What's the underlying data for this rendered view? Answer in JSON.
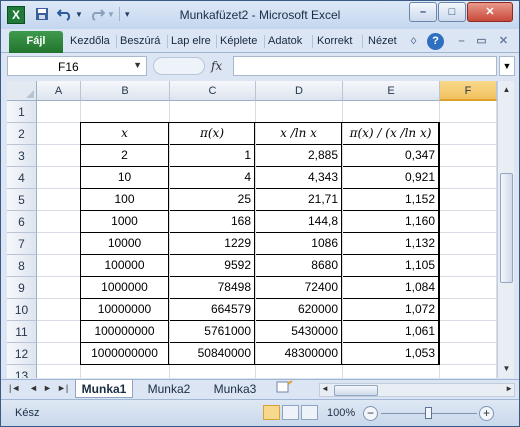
{
  "window": {
    "title": "Munkafüzet2 - Microsoft Excel"
  },
  "qat": {
    "save_icon": "save-icon",
    "undo_icon": "undo-icon",
    "redo_icon": "redo-icon"
  },
  "window_controls": {
    "minimize": "–",
    "maximize": "□",
    "close": "✕"
  },
  "ribbon": {
    "file_tab": "Fájl",
    "tabs": [
      "Kezdőla",
      "Beszúrá",
      "Lap elre",
      "Képlete",
      "Adatok",
      "Korrekt",
      "Nézet"
    ]
  },
  "formula_bar": {
    "name_box": "F16",
    "fx": "fx",
    "content": ""
  },
  "grid": {
    "columns": [
      "A",
      "B",
      "C",
      "D",
      "E",
      "F"
    ],
    "selected_column": "F",
    "rows": [
      "1",
      "2",
      "3",
      "4",
      "5",
      "6",
      "7",
      "8",
      "9",
      "10",
      "11",
      "12",
      "13"
    ],
    "table_headers": [
      "x",
      "π(x)",
      "x /ln x",
      "π(x) / (x /ln x)"
    ],
    "table_rows": [
      [
        "2",
        "1",
        "2,885",
        "0,347"
      ],
      [
        "10",
        "4",
        "4,343",
        "0,921"
      ],
      [
        "100",
        "25",
        "21,71",
        "1,152"
      ],
      [
        "1000",
        "168",
        "144,8",
        "1,160"
      ],
      [
        "10000",
        "1229",
        "1086",
        "1,132"
      ],
      [
        "100000",
        "9592",
        "8680",
        "1,105"
      ],
      [
        "1000000",
        "78498",
        "72400",
        "1,084"
      ],
      [
        "10000000",
        "664579",
        "620000",
        "1,072"
      ],
      [
        "100000000",
        "5761000",
        "5430000",
        "1,061"
      ],
      [
        "1000000000",
        "50840000",
        "48300000",
        "1,053"
      ]
    ]
  },
  "sheets": {
    "tabs": [
      "Munka1",
      "Munka2",
      "Munka3"
    ],
    "active": "Munka1"
  },
  "status": {
    "ready": "Kész",
    "zoom": "100%",
    "minus": "−",
    "plus": "+"
  }
}
